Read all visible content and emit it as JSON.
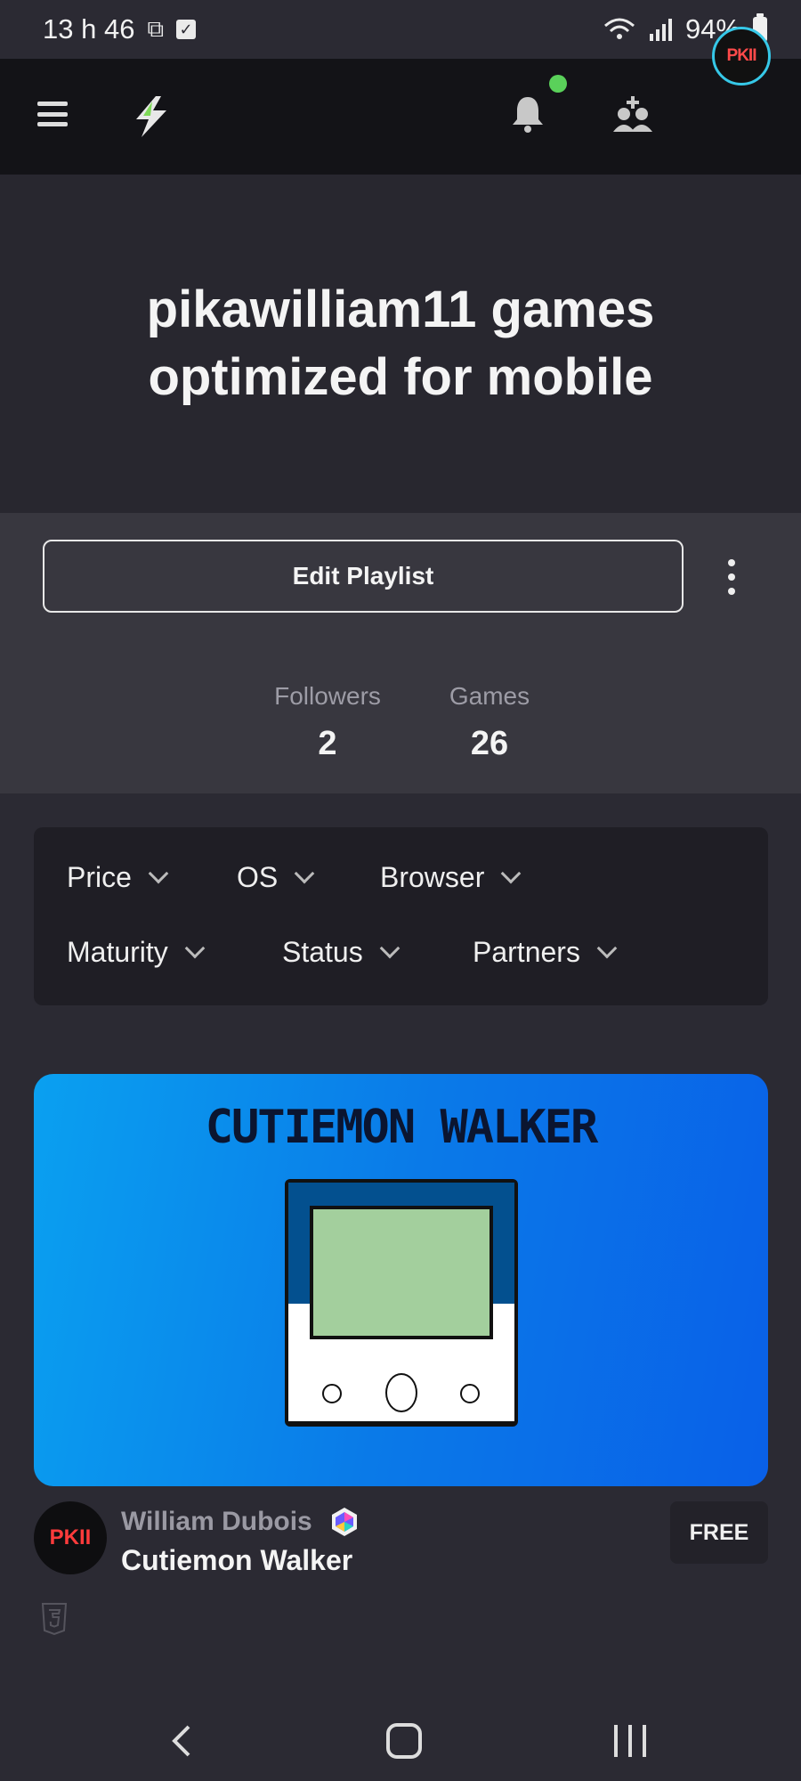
{
  "status_bar": {
    "time": "13 h 46",
    "battery": "94%",
    "icons": [
      "screen-record-icon",
      "checkbox-icon",
      "wifi-icon",
      "signal-icon",
      "battery-icon"
    ]
  },
  "header": {
    "icons": [
      "hamburger-icon",
      "logo-icon",
      "bell-icon",
      "friends-icon"
    ],
    "avatar_text": "PKII"
  },
  "playlist": {
    "title": "pikawilliam11 games optimized for mobile",
    "edit_label": "Edit Playlist",
    "stats": {
      "followers_label": "Followers",
      "followers_value": "2",
      "games_label": "Games",
      "games_value": "26"
    }
  },
  "filters": {
    "price": "Price",
    "os": "OS",
    "browser": "Browser",
    "maturity": "Maturity",
    "status": "Status",
    "partners": "Partners"
  },
  "game": {
    "thumbnail_title": "CUTIEMON WALKER",
    "creator_avatar_text": "PKII",
    "creator": "William Dubois",
    "title": "Cutiemon Walker",
    "price": "FREE",
    "platform_icon": "html5-icon"
  },
  "colors": {
    "background": "#2b2a33",
    "header": "#131317",
    "accent_online": "#5ad15a",
    "thumb_blue": "#0a7ae8"
  }
}
